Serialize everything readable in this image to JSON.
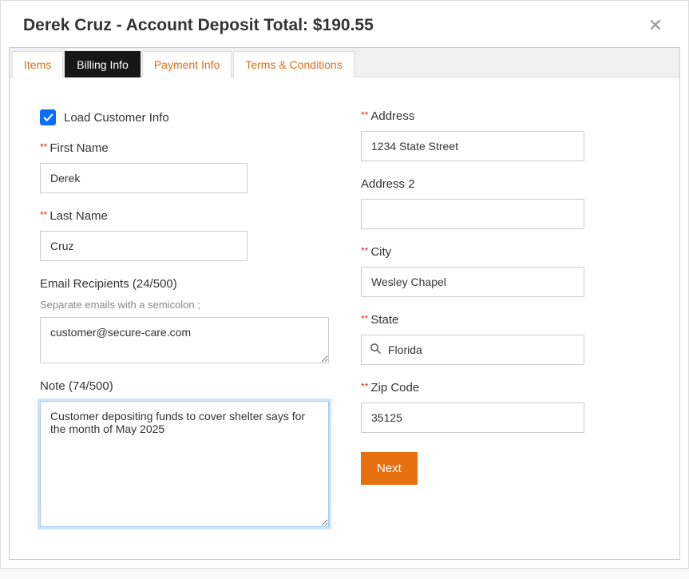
{
  "header": {
    "title": "Derek Cruz - Account Deposit Total: $190.55"
  },
  "tabs": {
    "items": "Items",
    "billing": "Billing Info",
    "payment": "Payment Info",
    "terms": "Terms & Conditions"
  },
  "form": {
    "load_customer_info_label": "Load Customer Info",
    "load_customer_info_checked": true,
    "first_name": {
      "label": "First Name",
      "value": "Derek"
    },
    "last_name": {
      "label": "Last Name",
      "value": "Cruz"
    },
    "email_recipients": {
      "label": "Email Recipients (24/500)",
      "hint": "Separate emails with a semicolon ;",
      "value": "customer@secure-care.com"
    },
    "note": {
      "label": "Note (74/500)",
      "value": "Customer depositing funds to cover shelter says for the month of May 2025"
    },
    "address": {
      "label": "Address",
      "value": "1234 State Street"
    },
    "address2": {
      "label": "Address 2",
      "value": ""
    },
    "city": {
      "label": "City",
      "value": "Wesley Chapel"
    },
    "state": {
      "label": "State",
      "value": "Florida"
    },
    "zip": {
      "label": "Zip Code",
      "value": "35125"
    },
    "next_button": "Next"
  }
}
